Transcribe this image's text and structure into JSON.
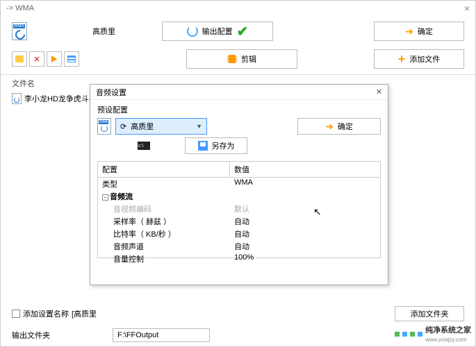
{
  "titlebar": {
    "title": "-> WMA"
  },
  "row1": {
    "quality_label": "高质里",
    "output_config_label": "输出配置",
    "confirm_label": "确定"
  },
  "row2": {
    "edit_label": "剪辑",
    "add_file_label": "添加文件"
  },
  "file_list": {
    "header": "文件名",
    "items": [
      "李小龙HD龙争虎斗.m..."
    ]
  },
  "pre_bottom": {
    "checkbox_label": "添加设置名称",
    "bracket_value": "[高质里",
    "add_folder_label": "添加文件夹"
  },
  "bottom": {
    "output_folder_label": "输出文件夹",
    "path": "F:\\FFOutput"
  },
  "dialog": {
    "title": "音频设置",
    "preset_label": "预设配置",
    "preset_value": "高质里",
    "confirm_label": "确定",
    "saveas_label": "另存为",
    "table": {
      "col_config": "配置",
      "col_value": "数值",
      "rows": [
        {
          "k": "类型",
          "v": "WMA",
          "style": "plain"
        },
        {
          "k": "音频流",
          "v": "",
          "style": "bold",
          "toggle": "-"
        },
        {
          "k": "音视频编码",
          "v": "默认",
          "style": "grey",
          "indent": true
        },
        {
          "k": "采样率（ 赫兹 ）",
          "v": "自动",
          "indent": true
        },
        {
          "k": "比特率（ KB/秒 ）",
          "v": "自动",
          "indent": true
        },
        {
          "k": "音频声道",
          "v": "自动",
          "indent": true
        },
        {
          "k": "音量控制",
          "v": "100%",
          "indent": true
        }
      ]
    }
  },
  "watermark": {
    "text": "纯净系统之家",
    "url": "www.ycwjzy.com"
  }
}
